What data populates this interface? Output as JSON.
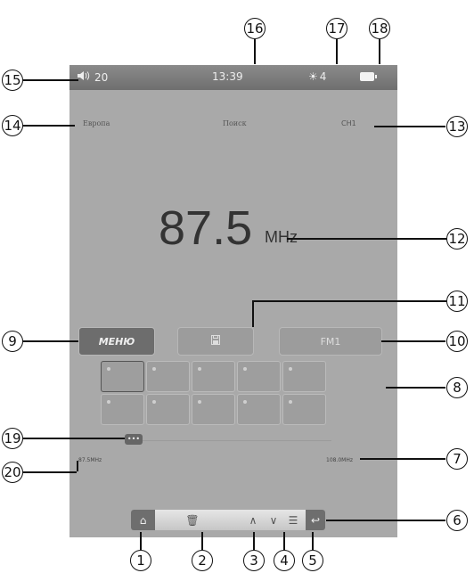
{
  "status": {
    "volume": "20",
    "time": "13:39",
    "brightness": "4"
  },
  "header": {
    "region": "Европа",
    "search": "Поиск",
    "channel": "CH1"
  },
  "frequency": {
    "value": "87.5",
    "unit": "MHz"
  },
  "tabs": {
    "menu_label": "МЕНЮ",
    "band_label": "FM1"
  },
  "tuner": {
    "min_label": "87.5MHz",
    "max_label": "108.0MHz"
  },
  "callouts": [
    "1",
    "2",
    "3",
    "4",
    "5",
    "6",
    "7",
    "8",
    "9",
    "10",
    "11",
    "12",
    "13",
    "14",
    "15",
    "16",
    "17",
    "18",
    "19",
    "20"
  ]
}
